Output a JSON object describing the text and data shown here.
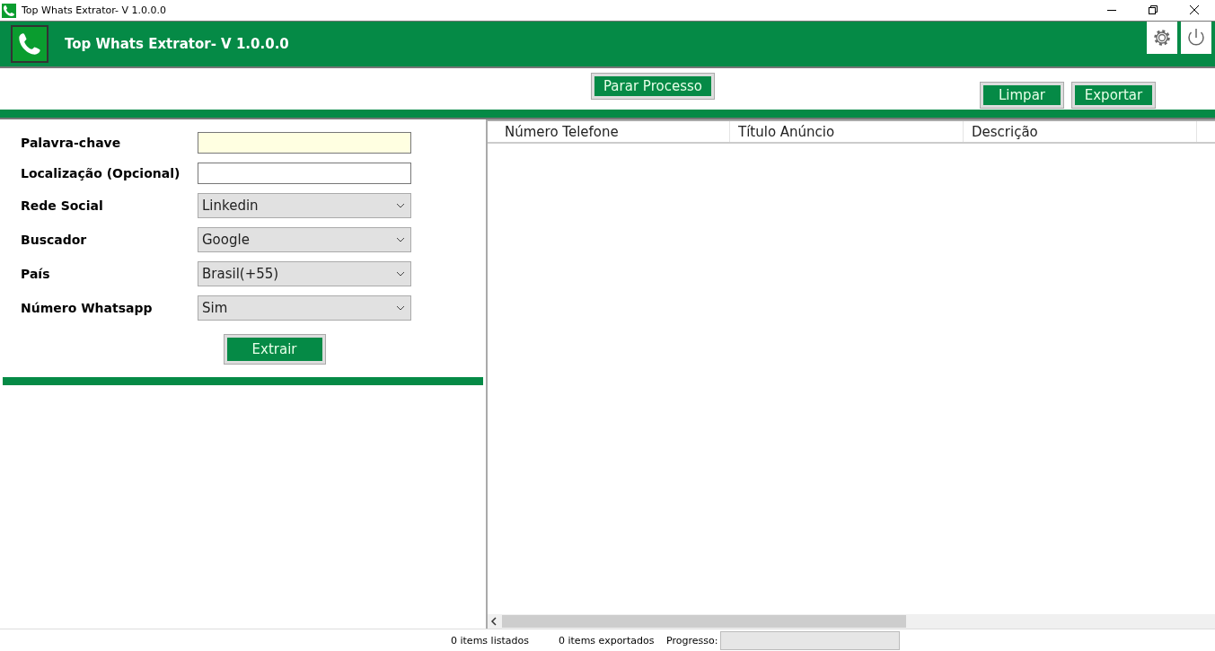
{
  "window": {
    "title": "Top Whats Extrator- V 1.0.0.0"
  },
  "header": {
    "title": "Top Whats Extrator- V 1.0.0.0"
  },
  "toolbar": {
    "center_buttons": [
      "Parar Processo"
    ],
    "right_buttons": [
      "Limpar",
      "Exportar"
    ]
  },
  "form": {
    "fields": [
      {
        "kind": "text",
        "label": "Palavra-chave",
        "highlighted": true
      },
      {
        "kind": "text",
        "label": "Localização (Opcional)",
        "highlighted": false
      },
      {
        "kind": "select",
        "label": "Rede Social",
        "value": "Linkedin"
      },
      {
        "kind": "select",
        "label": "Buscador",
        "value": "Google"
      },
      {
        "kind": "select",
        "label": "País",
        "value": "Brasil(+55)"
      },
      {
        "kind": "select",
        "label": "Número Whatsapp",
        "value": "Sim"
      }
    ],
    "submit": "Extrair"
  },
  "table": {
    "columns": [
      "Número Telefone",
      "Título Anúncio",
      "Descrição"
    ]
  },
  "status_bar": {
    "listed": "0 items listados",
    "exported": "0 items exportados",
    "progress_label": "Progresso:",
    "level": 0
  }
}
